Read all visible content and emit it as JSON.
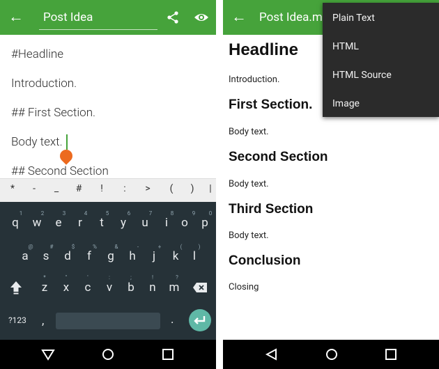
{
  "colors": {
    "appbar": "#46a33b",
    "keyboard": "#263238",
    "menu": "#2b2b2b",
    "cursor_handle": "#ec6a1f",
    "enter": "#5fb8a6"
  },
  "left": {
    "title": "Post Idea",
    "editor_lines": [
      "#Headline",
      "Introduction.",
      "## First Section.",
      "Body text.",
      "## Second Section"
    ],
    "symbols": [
      "*",
      "-",
      "_",
      "#",
      "!",
      ":",
      ">",
      "(",
      ")",
      "|"
    ],
    "keyboard": {
      "row1": [
        "q",
        "w",
        "e",
        "r",
        "t",
        "y",
        "u",
        "i",
        "o",
        "p"
      ],
      "row1_hints": [
        "1",
        "2",
        "3",
        "4",
        "5",
        "6",
        "7",
        "8",
        "9",
        "0"
      ],
      "row2": [
        "a",
        "s",
        "d",
        "f",
        "g",
        "h",
        "j",
        "k",
        "l"
      ],
      "row2_hints": [
        "@",
        "#",
        "$",
        "%",
        "&",
        "-",
        "+",
        "(",
        ")"
      ],
      "row3": [
        "z",
        "x",
        "c",
        "v",
        "b",
        "n",
        "m"
      ],
      "row3_hints": [
        "*",
        "\"",
        "'",
        ":",
        ";",
        "!",
        "?"
      ],
      "sym_label": "?123",
      "comma": ",",
      "period": ".",
      "icons": {
        "shift": "shift-icon",
        "backspace": "backspace-icon",
        "enter": "enter-icon"
      }
    },
    "nav_icons": [
      "back-triangle-icon",
      "home-circle-icon",
      "recents-square-icon"
    ]
  },
  "right": {
    "title": "Post Idea.m",
    "preview": {
      "h1": "Headline",
      "intro": "Introduction.",
      "sections": [
        {
          "heading": "First Section.",
          "body": "Body text."
        },
        {
          "heading": "Second Section",
          "body": "Body text."
        },
        {
          "heading": "Third Section",
          "body": "Body text."
        },
        {
          "heading": "Conclusion",
          "body": "Closing"
        }
      ]
    },
    "menu": [
      "Plain Text",
      "HTML",
      "HTML Source",
      "Image"
    ]
  }
}
